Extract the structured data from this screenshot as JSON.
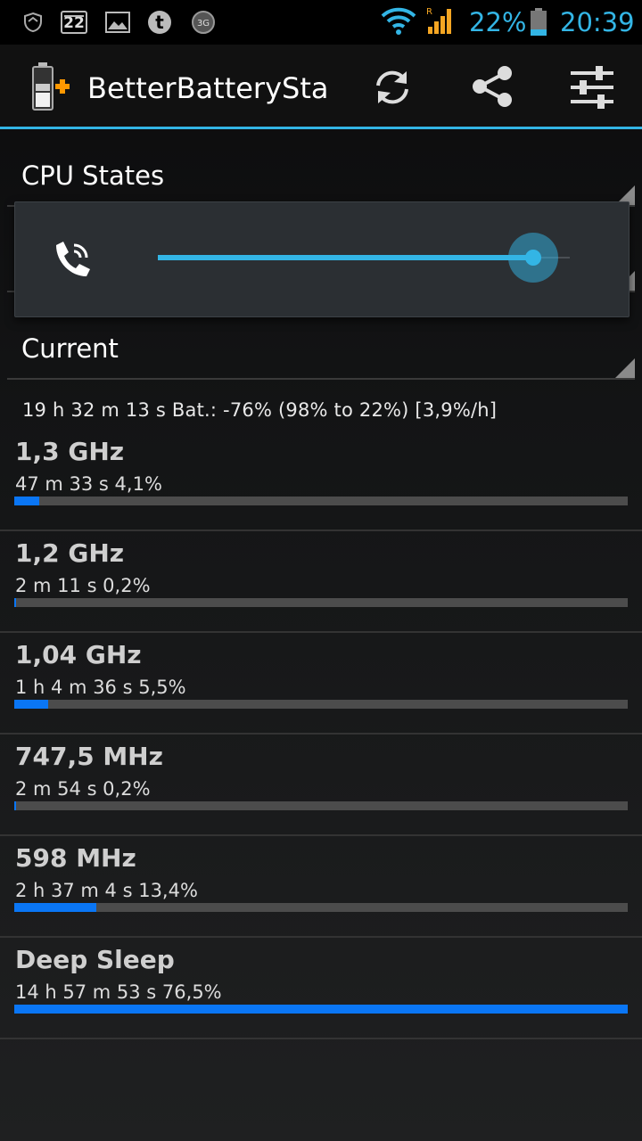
{
  "status_bar": {
    "icons": [
      "shield-icon",
      "calendar-icon",
      "image-icon",
      "tumblr-icon",
      "3g-icon",
      "wifi-icon",
      "signal-icon",
      "battery-icon"
    ],
    "date_badge": "22",
    "threeg_label": "3G",
    "roaming_label": "R",
    "battery_percent": "22%",
    "time": "20:39",
    "accent_color": "#33b5e5"
  },
  "action_bar": {
    "title": "BetterBatteryStats",
    "actions": [
      "refresh-icon",
      "share-icon",
      "settings-sliders-icon"
    ]
  },
  "spinners": {
    "stat_type": "CPU States",
    "reference": "Current"
  },
  "volume_popup": {
    "icon": "phone-volume-icon",
    "level_fraction": 0.87
  },
  "summary": "19 h 32 m 13 s  Bat.: -76% (98% to 22%) [3,9%/h]",
  "cpu_states": [
    {
      "name": "1,3 GHz",
      "detail": "47 m 33 s  4,1%",
      "fraction": 0.041
    },
    {
      "name": "1,2 GHz",
      "detail": "2 m 11 s  0,2%",
      "fraction": 0.002
    },
    {
      "name": "1,04 GHz",
      "detail": "1 h 4 m 36 s  5,5%",
      "fraction": 0.055
    },
    {
      "name": "747,5 MHz",
      "detail": "2 m 54 s  0,2%",
      "fraction": 0.002
    },
    {
      "name": "598 MHz",
      "detail": "2 h 37 m 4 s  13,4%",
      "fraction": 0.134
    },
    {
      "name": "Deep Sleep",
      "detail": "14 h 57 m 53 s  76,5%",
      "fraction": 1.0
    }
  ],
  "colors": {
    "bar_fill": "#0a76f5",
    "bar_track": "#4c4c4c"
  }
}
